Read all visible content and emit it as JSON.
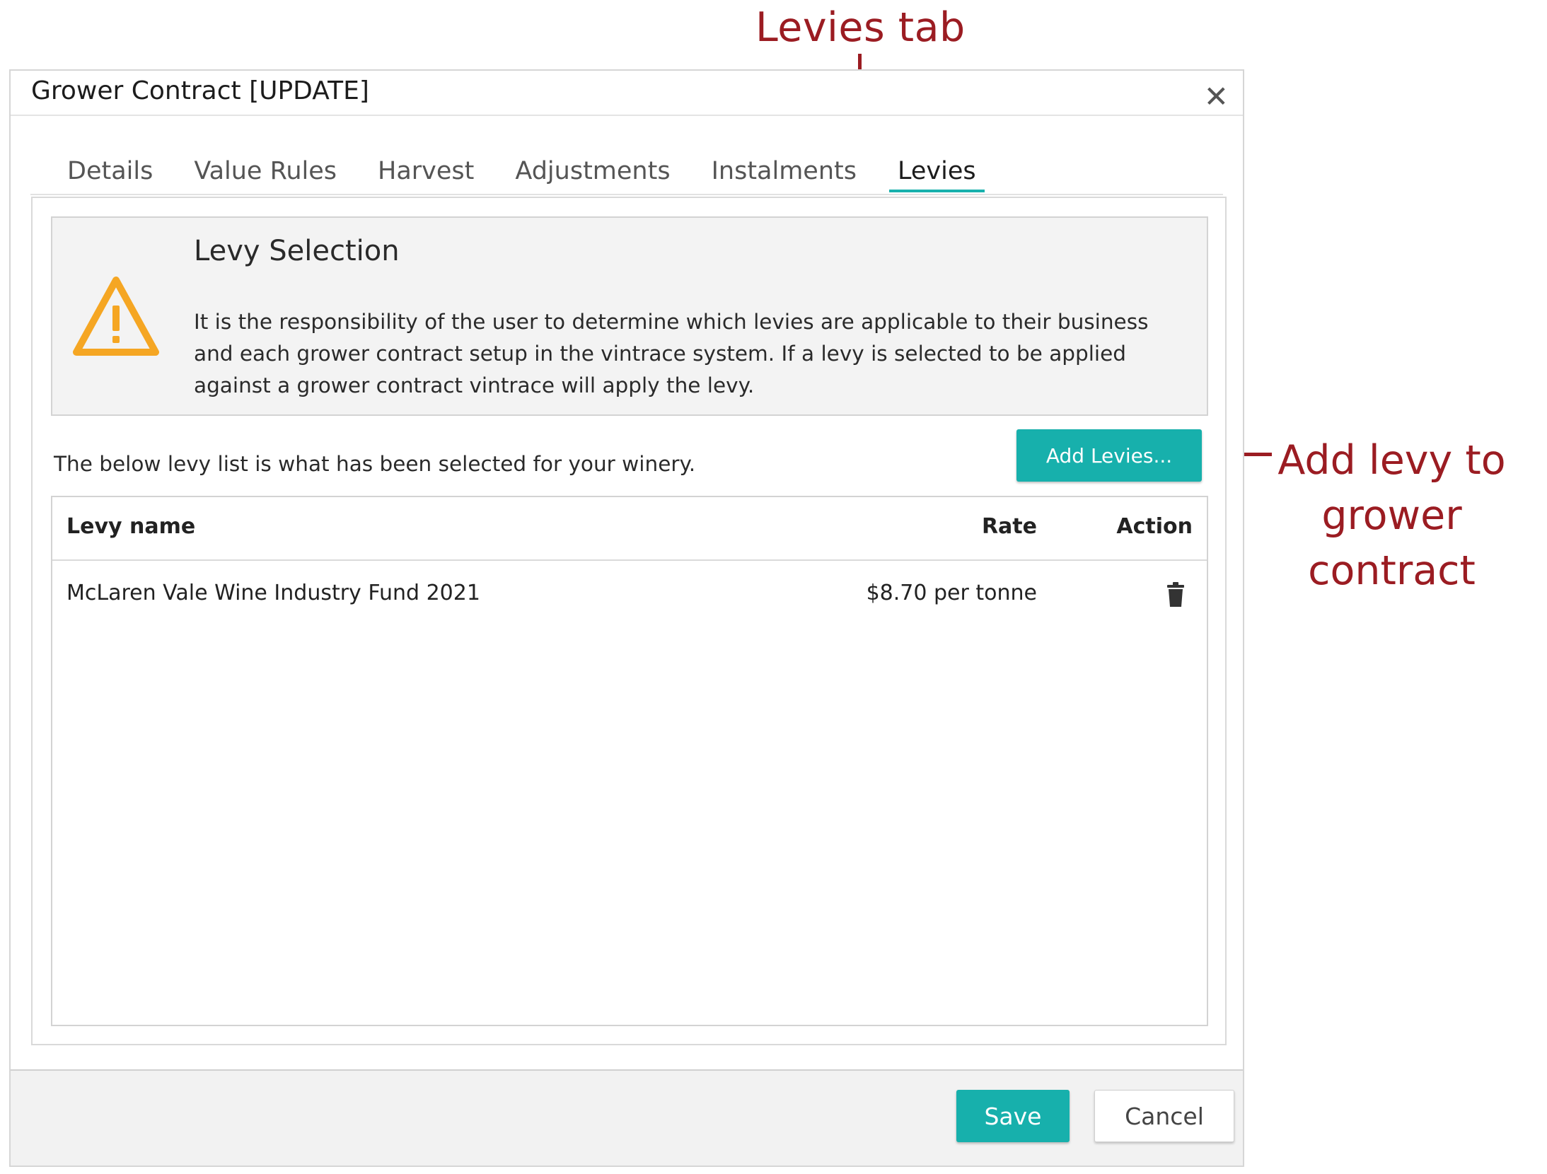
{
  "annotations": {
    "tab_callout": "Levies tab",
    "add_callout": [
      "Add levy to",
      "grower",
      "contract"
    ]
  },
  "dialog": {
    "title": "Grower Contract [UPDATE]",
    "close_icon": "close-icon"
  },
  "tabs": [
    {
      "label": "Details",
      "active": false
    },
    {
      "label": "Value Rules",
      "active": false
    },
    {
      "label": "Harvest",
      "active": false
    },
    {
      "label": "Adjustments",
      "active": false
    },
    {
      "label": "Instalments",
      "active": false
    },
    {
      "label": "Levies",
      "active": true
    }
  ],
  "warning": {
    "icon": "warning-icon",
    "title": "Levy Selection",
    "lines": [
      "It is the responsibility of the user to determine which levies are applicable to their business",
      "and each grower contract setup in the vintrace system. If a levy is selected to be applied",
      "against a grower contract vintrace will apply the levy."
    ]
  },
  "levies": {
    "intro": "The below levy list is what has been selected for your winery.",
    "add_label": "Add Levies...",
    "columns": {
      "name": "Levy name",
      "rate": "Rate",
      "action": "Action"
    },
    "rows": [
      {
        "name": "McLaren Vale Wine Industry Fund 2021",
        "rate": "$8.70 per tonne",
        "action_icon": "trash-icon"
      }
    ]
  },
  "footer": {
    "save_label": "Save",
    "cancel_label": "Cancel"
  },
  "colors": {
    "accent": "#17b0ac",
    "annotation": "#9b1c22",
    "warning": "#f5a623"
  }
}
